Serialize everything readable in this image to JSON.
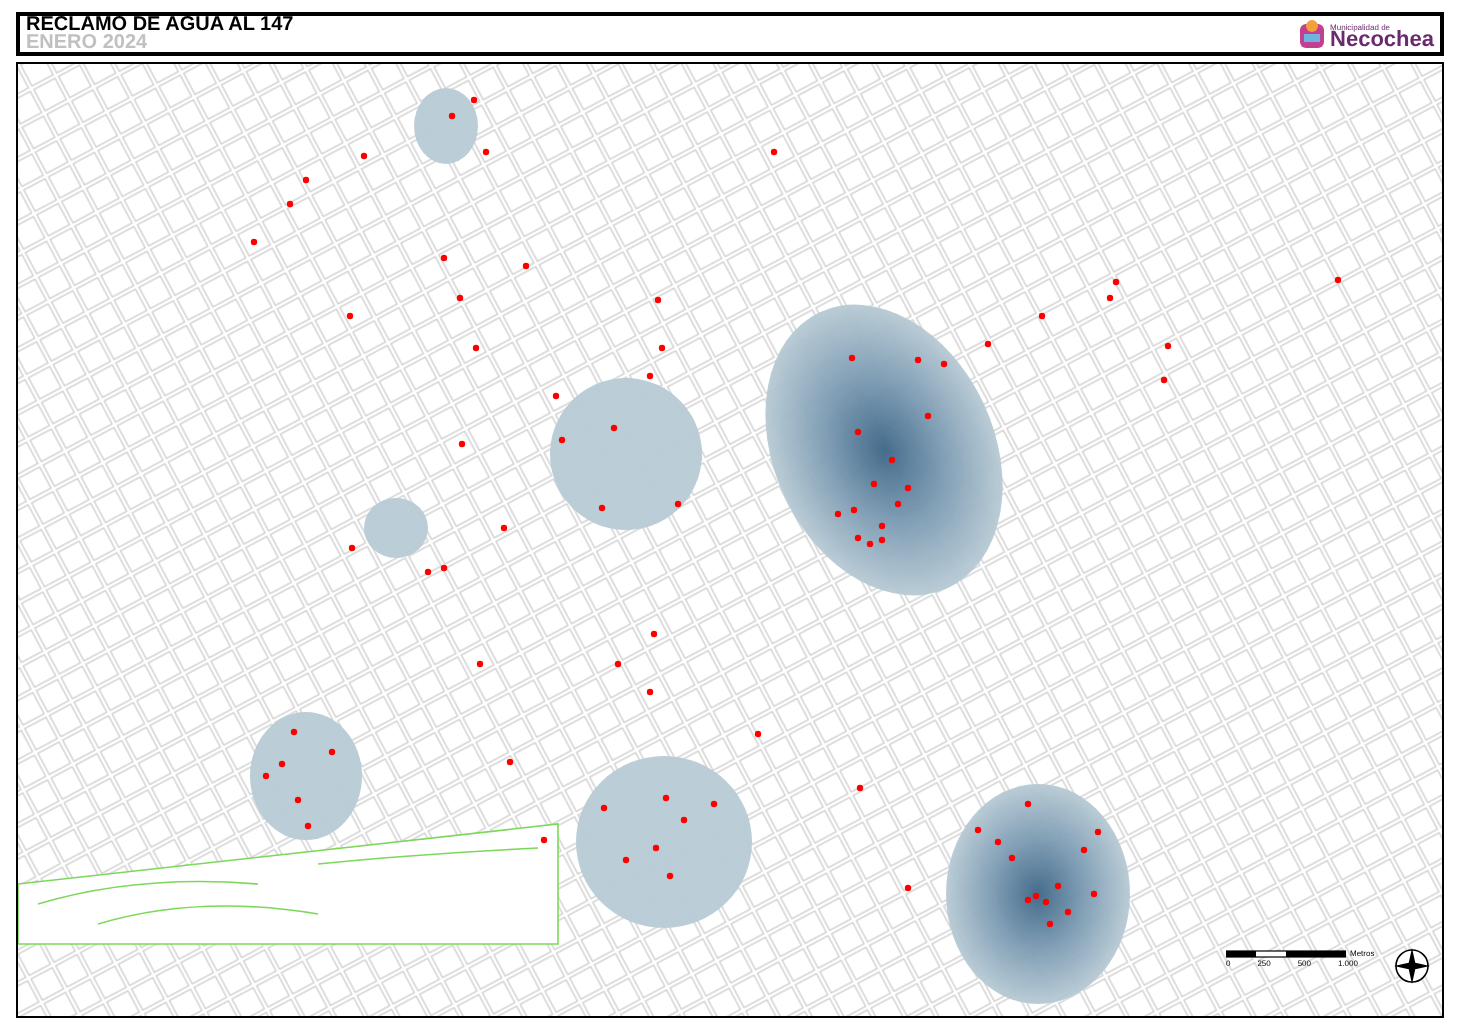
{
  "header": {
    "title": "RECLAMO DE AGUA AL 147",
    "subtitle": "ENERO 2024",
    "logo": {
      "caption": "Municipalidad de",
      "name": "Necochea"
    }
  },
  "map": {
    "scale_bar": {
      "ticks": [
        "0",
        "250",
        "500",
        "1.000"
      ],
      "unit": "Metros"
    }
  }
}
